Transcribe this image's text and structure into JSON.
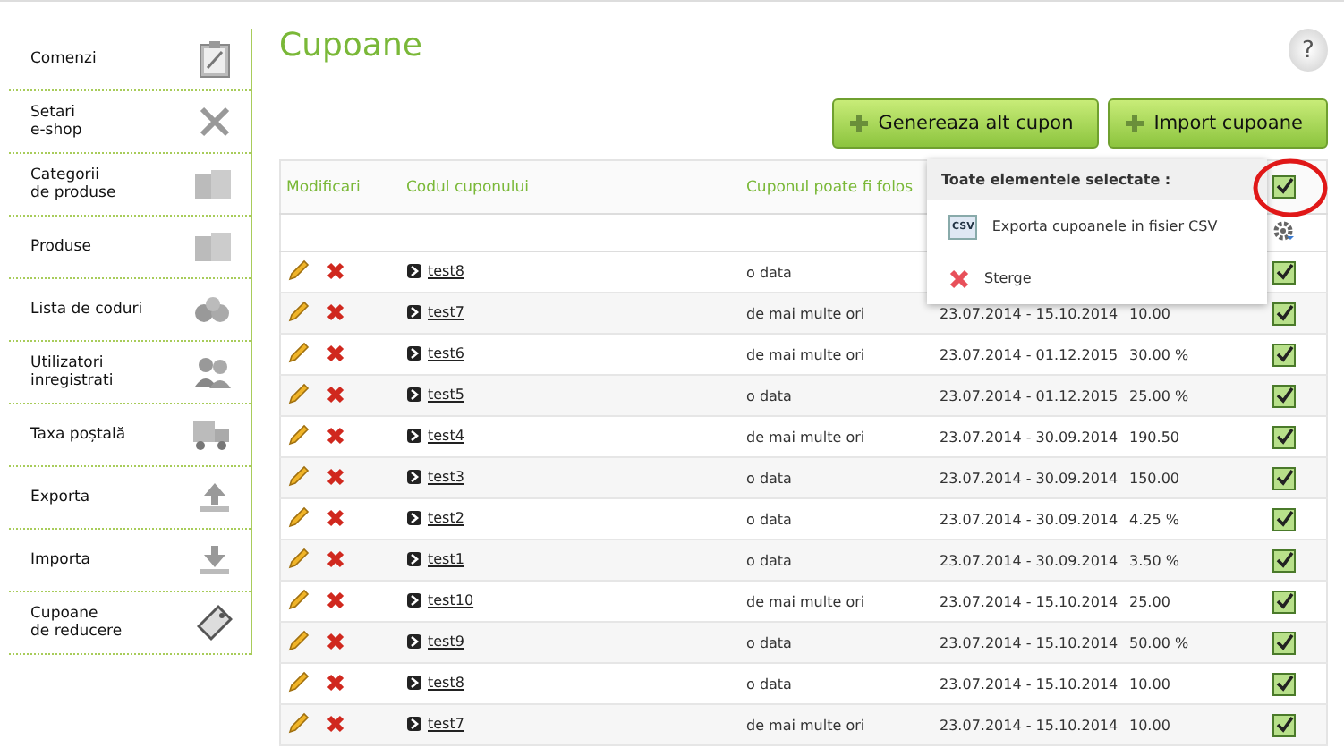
{
  "sidebar": {
    "items": [
      {
        "label": "Comenzi"
      },
      {
        "label": "Setari\ne-shop"
      },
      {
        "label": "Categorii\nde produse"
      },
      {
        "label": "Produse"
      },
      {
        "label": "Lista de coduri"
      },
      {
        "label": "Utilizatori\ninregistrati"
      },
      {
        "label": "Taxa poștală"
      },
      {
        "label": "Exporta"
      },
      {
        "label": "Importa"
      },
      {
        "label": "Cupoane\nde reducere"
      }
    ]
  },
  "page": {
    "title": "Cupoane",
    "help": "?"
  },
  "buttons": [
    "Genereaza alt cupon",
    "Import cupoane"
  ],
  "table": {
    "columns": [
      "Modificari",
      "Codul cuponului",
      "Cuponul poate fi folos"
    ],
    "header_checked": true,
    "rows": [
      {
        "code": "test8",
        "usage": "o data",
        "checked": true
      },
      {
        "code": "test7",
        "usage": "de mai multe ori",
        "dates": "23.07.2014 - 15.10.2014",
        "value": "10.00",
        "checked": true
      },
      {
        "code": "test6",
        "usage": "de mai multe ori",
        "dates": "23.07.2014 - 01.12.2015",
        "value": "30.00 %",
        "checked": true
      },
      {
        "code": "test5",
        "usage": "o data",
        "dates": "23.07.2014 - 01.12.2015",
        "value": "25.00 %",
        "checked": true
      },
      {
        "code": "test4",
        "usage": "de mai multe ori",
        "dates": "23.07.2014 - 30.09.2014",
        "value": "190.50",
        "checked": true
      },
      {
        "code": "test3",
        "usage": "o data",
        "dates": "23.07.2014 - 30.09.2014",
        "value": "150.00",
        "checked": true
      },
      {
        "code": "test2",
        "usage": "o data",
        "dates": "23.07.2014 - 30.09.2014",
        "value": "4.25 %",
        "checked": true
      },
      {
        "code": "test1",
        "usage": "o data",
        "dates": "23.07.2014 - 30.09.2014",
        "value": "3.50 %",
        "checked": true
      },
      {
        "code": "test10",
        "usage": "de mai multe ori",
        "dates": "23.07.2014 - 15.10.2014",
        "value": "25.00",
        "checked": true
      },
      {
        "code": "test9",
        "usage": "o data",
        "dates": "23.07.2014 - 15.10.2014",
        "value": "50.00 %",
        "checked": true
      },
      {
        "code": "test8",
        "usage": "o data",
        "dates": "23.07.2014 - 15.10.2014",
        "value": "10.00",
        "checked": true
      },
      {
        "code": "test7",
        "usage": "de mai multe ori",
        "dates": "23.07.2014 - 15.10.2014",
        "value": "10.00",
        "checked": true
      }
    ]
  },
  "popup": {
    "title": "Toate elementele selectate :",
    "items": [
      {
        "label": "Exporta cupoanele in fisier CSV",
        "icon_text": "CSV"
      },
      {
        "label": "Sterge"
      }
    ]
  }
}
